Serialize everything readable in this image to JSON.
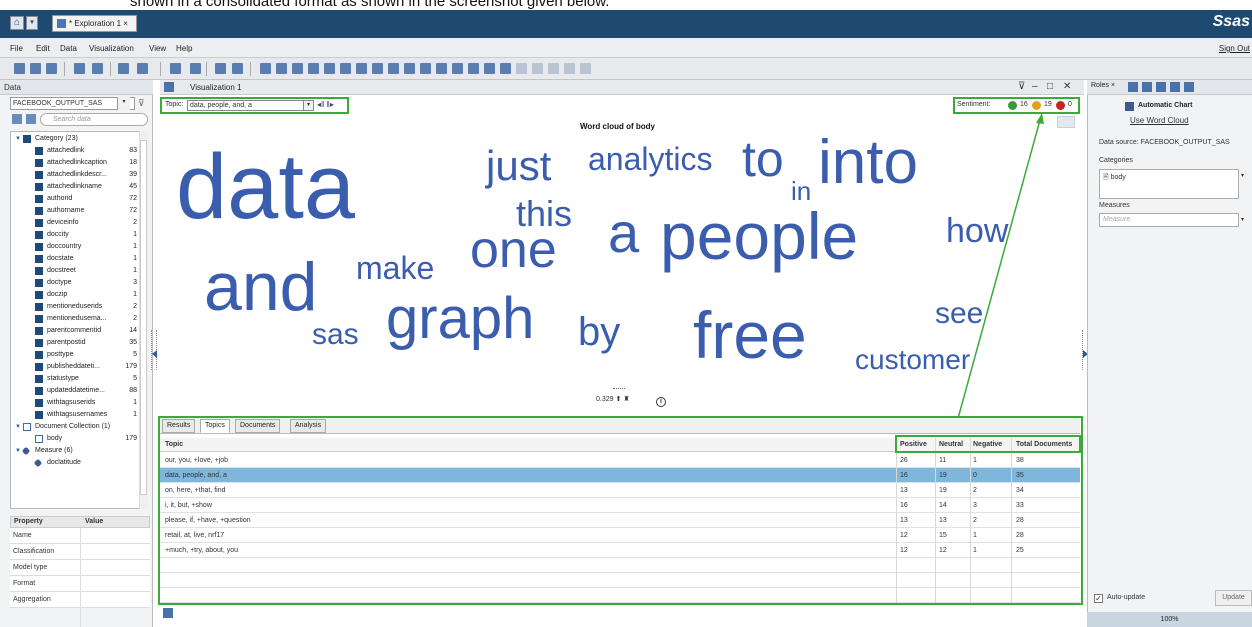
{
  "caption": "shown in a consolidated format as shown in the screenshot given below.",
  "app": {
    "tab_title": "* Exploration 1",
    "tab_close": "×",
    "brand": "Ssas",
    "menu": [
      "File",
      "Edit",
      "Data",
      "Visualization",
      "View",
      "Help"
    ],
    "sign_out": "Sign Out"
  },
  "left_panel": {
    "title": "Data",
    "source": "FACEBOOK_OUTPUT_SAS",
    "search_placeholder": "Search data",
    "groups": [
      {
        "label": "Category (23)",
        "kind": "category"
      },
      {
        "label": "Document Collection (1)",
        "kind": "doc"
      },
      {
        "label": "Measure (6)",
        "kind": "measure"
      }
    ],
    "category_items": [
      {
        "name": "attachedlink",
        "count": "83"
      },
      {
        "name": "attachedlinkcaption",
        "count": "18"
      },
      {
        "name": "attachedlinkdescr...",
        "count": "39"
      },
      {
        "name": "attachedlinkname",
        "count": "45"
      },
      {
        "name": "authorid",
        "count": "72"
      },
      {
        "name": "authorname",
        "count": "72"
      },
      {
        "name": "deviceinfo",
        "count": "2"
      },
      {
        "name": "doccity",
        "count": "1"
      },
      {
        "name": "doccountry",
        "count": "1"
      },
      {
        "name": "docstate",
        "count": "1"
      },
      {
        "name": "docstreet",
        "count": "1"
      },
      {
        "name": "doctype",
        "count": "3"
      },
      {
        "name": "doczip",
        "count": "1"
      },
      {
        "name": "mentioneduserids",
        "count": "2"
      },
      {
        "name": "mentionedusema...",
        "count": "2"
      },
      {
        "name": "parentcommentid",
        "count": "14"
      },
      {
        "name": "parentpostid",
        "count": "35"
      },
      {
        "name": "posttype",
        "count": "5"
      },
      {
        "name": "publisheddateti...",
        "count": "179"
      },
      {
        "name": "statustype",
        "count": "5"
      },
      {
        "name": "updateddatetime...",
        "count": "88"
      },
      {
        "name": "withtagsuserids",
        "count": "1"
      },
      {
        "name": "withtagsusernames",
        "count": "1"
      }
    ],
    "doc_items": [
      {
        "name": "body",
        "count": "179"
      }
    ],
    "measure_items": [
      {
        "name": "doclatitude",
        "count": ""
      }
    ],
    "property_header": {
      "property": "Property",
      "value": "Value"
    },
    "properties": [
      "Name",
      "Classification",
      "Model type",
      "Format",
      "Aggregation"
    ]
  },
  "viz": {
    "title": "Visualization 1",
    "topic_label": "Topic:",
    "topic_value": "data, people, and, a",
    "sentiment_label": "Sentiment:",
    "sentiment": {
      "positive": "16",
      "neutral": "19",
      "negative": "0"
    },
    "cloud_title": "Word cloud of body",
    "words": [
      {
        "text": "data",
        "size": 92
      },
      {
        "text": "and",
        "size": 68
      },
      {
        "text": "graph",
        "size": 58
      },
      {
        "text": "people",
        "size": 66
      },
      {
        "text": "free",
        "size": 66
      },
      {
        "text": "into",
        "size": 62
      },
      {
        "text": "one",
        "size": 52
      },
      {
        "text": "a",
        "size": 56
      },
      {
        "text": "to",
        "size": 50
      },
      {
        "text": "just",
        "size": 42
      },
      {
        "text": "this",
        "size": 36
      },
      {
        "text": "by",
        "size": 40
      },
      {
        "text": "analytics",
        "size": 32
      },
      {
        "text": "make",
        "size": 32
      },
      {
        "text": "how",
        "size": 34
      },
      {
        "text": "see",
        "size": 30
      },
      {
        "text": "customer",
        "size": 28
      },
      {
        "text": "sas",
        "size": 30
      },
      {
        "text": "in",
        "size": 26
      }
    ],
    "slider_value": "0.329",
    "info": "i"
  },
  "table": {
    "tabs": [
      "Results",
      "Topics",
      "Documents",
      "Analysis"
    ],
    "selected_tab": "Topics",
    "columns": [
      "Topic",
      "Positive",
      "Neutral",
      "Negative",
      "Total Documents"
    ],
    "rows": [
      [
        "our, you, +love, +job",
        "26",
        "11",
        "1",
        "38"
      ],
      [
        "data, people, and, a",
        "16",
        "19",
        "0",
        "35"
      ],
      [
        "on, here, +that, find",
        "13",
        "19",
        "2",
        "34"
      ],
      [
        "i, it, but, +show",
        "16",
        "14",
        "3",
        "33"
      ],
      [
        "please, if, +have, +question",
        "13",
        "13",
        "2",
        "28"
      ],
      [
        "retail, at, live, nrf17",
        "12",
        "15",
        "1",
        "28"
      ],
      [
        "+much, +try, about, you",
        "12",
        "12",
        "1",
        "25"
      ]
    ],
    "highlighted_row": 1
  },
  "right_panel": {
    "tab": "Roles",
    "auto_chart": "Automatic Chart",
    "use_link": "Use Word Cloud",
    "data_source": "Data source: FACEBOOK_OUTPUT_SAS",
    "categories_label": "Categories",
    "category_value": "body",
    "measures_label": "Measures",
    "measure_placeholder": "Measure",
    "auto_update": "Auto-update",
    "update_btn": "Update",
    "zoom": "100%"
  },
  "colors": {
    "accent": "#3a5dae",
    "highlight": "#3aaa3a",
    "header": "#1e4a72",
    "row_highlight": "#7fb6dc"
  }
}
